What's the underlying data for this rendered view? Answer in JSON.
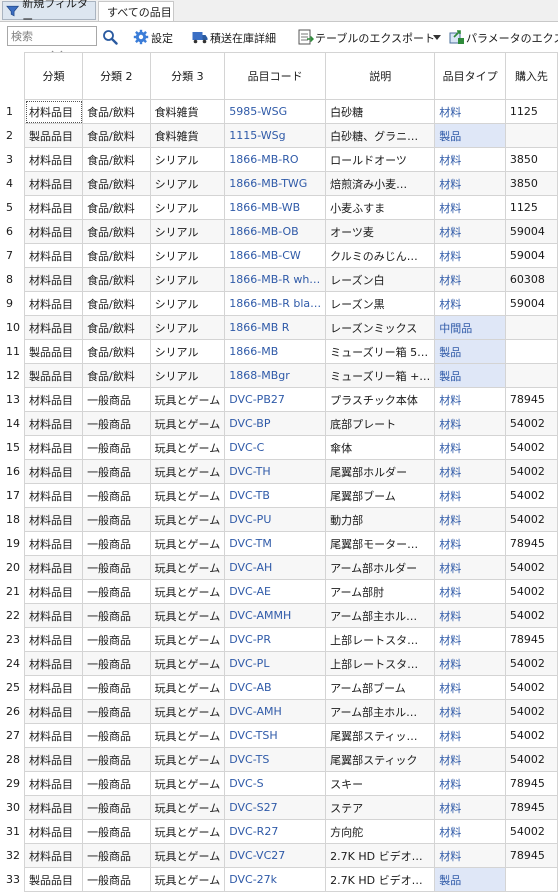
{
  "tabs": {
    "filter_label": "新規フィルター",
    "all_label": "すべての品目"
  },
  "toolbar": {
    "search_placeholder": "検索",
    "settings_label": "設定",
    "stock_detail_label": "積送在庫詳細",
    "export_table_label": "テーブルのエクスポート",
    "export_params_label": "パラメータのエクスポ"
  },
  "columns": [
    "分類",
    "分類 2",
    "分類 3",
    "品目コード",
    "説明",
    "品目タイプ",
    "購入先"
  ],
  "rows": [
    {
      "n": "1",
      "c1": "材料品目",
      "c2": "食品/飲料",
      "c3": "食料雑貨",
      "code": "5985-WSG",
      "desc": "白砂糖",
      "type": "材料",
      "vendor": "1125",
      "hl": false
    },
    {
      "n": "2",
      "c1": "製品品目",
      "c2": "食品/飲料",
      "c3": "食料雑貨",
      "code": "1115-WSg",
      "desc": "白砂糖、グラニ…",
      "type": "製品",
      "vendor": "",
      "hl": true
    },
    {
      "n": "3",
      "c1": "材料品目",
      "c2": "食品/飲料",
      "c3": "シリアル",
      "code": "1866-MB-RO",
      "desc": "ロールドオーツ",
      "type": "材料",
      "vendor": "3850",
      "hl": false
    },
    {
      "n": "4",
      "c1": "材料品目",
      "c2": "食品/飲料",
      "c3": "シリアル",
      "code": "1866-MB-TWG",
      "desc": "焙煎済み小麦…",
      "type": "材料",
      "vendor": "3850",
      "hl": false
    },
    {
      "n": "5",
      "c1": "材料品目",
      "c2": "食品/飲料",
      "c3": "シリアル",
      "code": "1866-MB-WB",
      "desc": "小麦ふすま",
      "type": "材料",
      "vendor": "1125",
      "hl": false
    },
    {
      "n": "6",
      "c1": "材料品目",
      "c2": "食品/飲料",
      "c3": "シリアル",
      "code": "1866-MB-OB",
      "desc": "オーツ麦",
      "type": "材料",
      "vendor": "59004",
      "hl": false
    },
    {
      "n": "7",
      "c1": "材料品目",
      "c2": "食品/飲料",
      "c3": "シリアル",
      "code": "1866-MB-CW",
      "desc": "クルミのみじん…",
      "type": "材料",
      "vendor": "59004",
      "hl": false
    },
    {
      "n": "8",
      "c1": "材料品目",
      "c2": "食品/飲料",
      "c3": "シリアル",
      "code": "1866-MB-R wh…",
      "desc": "レーズン白",
      "type": "材料",
      "vendor": "60308",
      "hl": false
    },
    {
      "n": "9",
      "c1": "材料品目",
      "c2": "食品/飲料",
      "c3": "シリアル",
      "code": "1866-MB-R bla…",
      "desc": "レーズン黒",
      "type": "材料",
      "vendor": "59004",
      "hl": false
    },
    {
      "n": "10",
      "c1": "材料品目",
      "c2": "食品/飲料",
      "c3": "シリアル",
      "code": "1866-MB R",
      "desc": "レーズンミックス",
      "type": "中間品",
      "vendor": "",
      "hl": true
    },
    {
      "n": "11",
      "c1": "製品品目",
      "c2": "食品/飲料",
      "c3": "シリアル",
      "code": "1866-MB",
      "desc": "ミューズリー箱 5…",
      "type": "製品",
      "vendor": "",
      "hl": true
    },
    {
      "n": "12",
      "c1": "製品品目",
      "c2": "食品/飲料",
      "c3": "シリアル",
      "code": "1868-MBgr",
      "desc": "ミューズリー箱 +…",
      "type": "製品",
      "vendor": "",
      "hl": true
    },
    {
      "n": "13",
      "c1": "材料品目",
      "c2": "一般商品",
      "c3": "玩具とゲーム",
      "code": "DVC-PB27",
      "desc": "プラスチック本体",
      "type": "材料",
      "vendor": "78945",
      "hl": false
    },
    {
      "n": "14",
      "c1": "材料品目",
      "c2": "一般商品",
      "c3": "玩具とゲーム",
      "code": "DVC-BP",
      "desc": "底部プレート",
      "type": "材料",
      "vendor": "54002",
      "hl": false
    },
    {
      "n": "15",
      "c1": "材料品目",
      "c2": "一般商品",
      "c3": "玩具とゲーム",
      "code": "DVC-C",
      "desc": "傘体",
      "type": "材料",
      "vendor": "54002",
      "hl": false
    },
    {
      "n": "16",
      "c1": "材料品目",
      "c2": "一般商品",
      "c3": "玩具とゲーム",
      "code": "DVC-TH",
      "desc": "尾翼部ホルダー",
      "type": "材料",
      "vendor": "54002",
      "hl": false
    },
    {
      "n": "17",
      "c1": "材料品目",
      "c2": "一般商品",
      "c3": "玩具とゲーム",
      "code": "DVC-TB",
      "desc": "尾翼部ブーム",
      "type": "材料",
      "vendor": "54002",
      "hl": false
    },
    {
      "n": "18",
      "c1": "材料品目",
      "c2": "一般商品",
      "c3": "玩具とゲーム",
      "code": "DVC-PU",
      "desc": "動力部",
      "type": "材料",
      "vendor": "54002",
      "hl": false
    },
    {
      "n": "19",
      "c1": "材料品目",
      "c2": "一般商品",
      "c3": "玩具とゲーム",
      "code": "DVC-TM",
      "desc": "尾翼部モーター…",
      "type": "材料",
      "vendor": "78945",
      "hl": false
    },
    {
      "n": "20",
      "c1": "材料品目",
      "c2": "一般商品",
      "c3": "玩具とゲーム",
      "code": "DVC-AH",
      "desc": "アーム部ホルダー",
      "type": "材料",
      "vendor": "54002",
      "hl": false
    },
    {
      "n": "21",
      "c1": "材料品目",
      "c2": "一般商品",
      "c3": "玩具とゲーム",
      "code": "DVC-AE",
      "desc": "アーム部肘",
      "type": "材料",
      "vendor": "54002",
      "hl": false
    },
    {
      "n": "22",
      "c1": "材料品目",
      "c2": "一般商品",
      "c3": "玩具とゲーム",
      "code": "DVC-AMMH",
      "desc": "アーム部主ホル…",
      "type": "材料",
      "vendor": "54002",
      "hl": false
    },
    {
      "n": "23",
      "c1": "材料品目",
      "c2": "一般商品",
      "c3": "玩具とゲーム",
      "code": "DVC-PR",
      "desc": "上部レートスタ…",
      "type": "材料",
      "vendor": "78945",
      "hl": false
    },
    {
      "n": "24",
      "c1": "材料品目",
      "c2": "一般商品",
      "c3": "玩具とゲーム",
      "code": "DVC-PL",
      "desc": "上部レートスタ…",
      "type": "材料",
      "vendor": "54002",
      "hl": false
    },
    {
      "n": "25",
      "c1": "材料品目",
      "c2": "一般商品",
      "c3": "玩具とゲーム",
      "code": "DVC-AB",
      "desc": "アーム部ブーム",
      "type": "材料",
      "vendor": "54002",
      "hl": false
    },
    {
      "n": "26",
      "c1": "材料品目",
      "c2": "一般商品",
      "c3": "玩具とゲーム",
      "code": "DVC-AMH",
      "desc": "アーム部主ホル…",
      "type": "材料",
      "vendor": "54002",
      "hl": false
    },
    {
      "n": "27",
      "c1": "材料品目",
      "c2": "一般商品",
      "c3": "玩具とゲーム",
      "code": "DVC-TSH",
      "desc": "尾翼部スティッ…",
      "type": "材料",
      "vendor": "54002",
      "hl": false
    },
    {
      "n": "28",
      "c1": "材料品目",
      "c2": "一般商品",
      "c3": "玩具とゲーム",
      "code": "DVC-TS",
      "desc": "尾翼部スティック",
      "type": "材料",
      "vendor": "54002",
      "hl": false
    },
    {
      "n": "29",
      "c1": "材料品目",
      "c2": "一般商品",
      "c3": "玩具とゲーム",
      "code": "DVC-S",
      "desc": "スキー",
      "type": "材料",
      "vendor": "78945",
      "hl": false
    },
    {
      "n": "30",
      "c1": "材料品目",
      "c2": "一般商品",
      "c3": "玩具とゲーム",
      "code": "DVC-S27",
      "desc": "ステア",
      "type": "材料",
      "vendor": "78945",
      "hl": false
    },
    {
      "n": "31",
      "c1": "材料品目",
      "c2": "一般商品",
      "c3": "玩具とゲーム",
      "code": "DVC-R27",
      "desc": "方向舵",
      "type": "材料",
      "vendor": "54002",
      "hl": false
    },
    {
      "n": "32",
      "c1": "材料品目",
      "c2": "一般商品",
      "c3": "玩具とゲーム",
      "code": "DVC-VC27",
      "desc": "2.7K HD ビデオ…",
      "type": "材料",
      "vendor": "78945",
      "hl": false
    },
    {
      "n": "33",
      "c1": "製品品目",
      "c2": "一般商品",
      "c3": "玩具とゲーム",
      "code": "DVC-27k",
      "desc": "2.7K HD ビデオ…",
      "type": "製品",
      "vendor": "",
      "hl": true
    }
  ],
  "colors": {
    "link_blue": "#2f5aa8",
    "type_highlight": "#dfe7f7",
    "alt_row": "#f7f7f7"
  },
  "icons": [
    "funnel-icon",
    "magnifier-icon",
    "gear-icon",
    "truck-icon",
    "table-export-icon",
    "dropdown-arrow-icon",
    "params-export-icon",
    "chevron-down-icon"
  ]
}
